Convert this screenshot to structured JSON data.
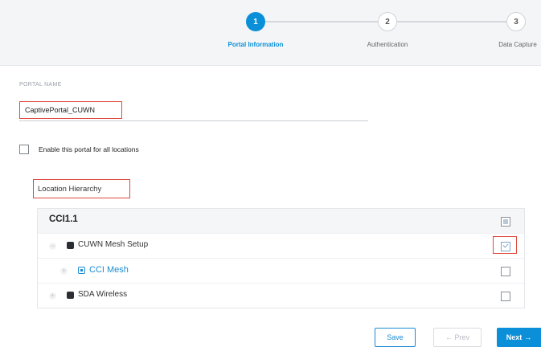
{
  "wizard": {
    "steps": [
      {
        "number": "1",
        "label": "Portal Information",
        "active": true
      },
      {
        "number": "2",
        "label": "Authentication",
        "active": false
      },
      {
        "number": "3",
        "label": "Data Capture",
        "active": false
      }
    ]
  },
  "portal_name": {
    "label": "PORTAL NAME",
    "value": "CaptivePortal_CUWN"
  },
  "enable_all": {
    "label": "Enable this portal for all locations",
    "checked": false
  },
  "location": {
    "heading": "Location Hierarchy",
    "tree": [
      {
        "label": "CCI1.1",
        "level": 0,
        "state": "partial"
      },
      {
        "label": "CUWN Mesh Setup",
        "level": 1,
        "state": "checked",
        "toggle": "−",
        "icon": "building-icon"
      },
      {
        "label": "CCI Mesh",
        "level": 2,
        "state": "unchecked",
        "toggle": "+",
        "icon": "floor-icon"
      },
      {
        "label": "SDA Wireless",
        "level": 1,
        "state": "unchecked",
        "toggle": "+",
        "icon": "building-icon"
      }
    ]
  },
  "actions": {
    "save": "Save",
    "prev": "← Prev",
    "next": "Next",
    "next_arrow": "→"
  },
  "colors": {
    "accent": "#0a8fd8",
    "highlight": "#e0483d",
    "link": "#1a8bd3"
  }
}
